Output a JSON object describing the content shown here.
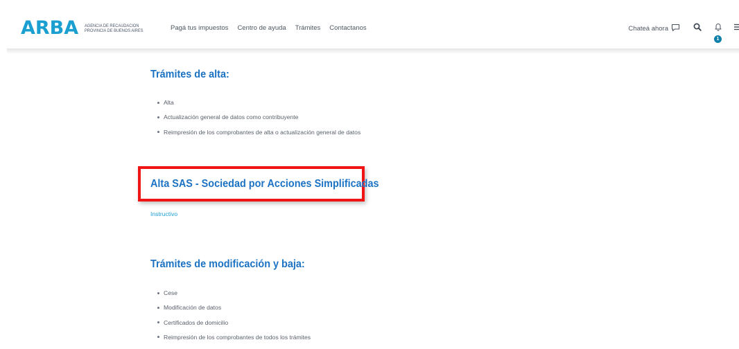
{
  "header": {
    "logo": {
      "mark": "ARBA",
      "sub_line1": "AGENCIA DE RECAUDACIÓN",
      "sub_line2": "PROVINCIA DE BUENOS AIRES"
    },
    "nav": [
      "Pagá tus impuestos",
      "Centro de ayuda",
      "Trámites",
      "Contactanos"
    ],
    "chat_label": "Chateá ahora",
    "notification_count": "1",
    "icons": {
      "chat": "chat-bubble-icon",
      "search": "search-icon",
      "notifications": "bell-icon",
      "menu": "menu-icon"
    }
  },
  "main": {
    "sections": [
      {
        "title": "Trámites de alta:",
        "items": [
          "Alta",
          "Actualización general de datos como contribuyente",
          "Reimpresión de los comprobantes de alta o actualización general de datos"
        ]
      },
      {
        "title": "Alta SAS - Sociedad por Acciones Simplificadas",
        "link": "Instructivo"
      },
      {
        "title": "Trámites de modificación y baja:",
        "items": [
          "Cese",
          "Modificación de datos",
          "Certificados de domicilio",
          "Reimpresión de los comprobantes de todos los trámites"
        ]
      }
    ]
  },
  "colors": {
    "brand": "#1a9fd0",
    "heading": "#1c73c4",
    "highlight": "#f01414",
    "badge": "#0d7fa9"
  }
}
